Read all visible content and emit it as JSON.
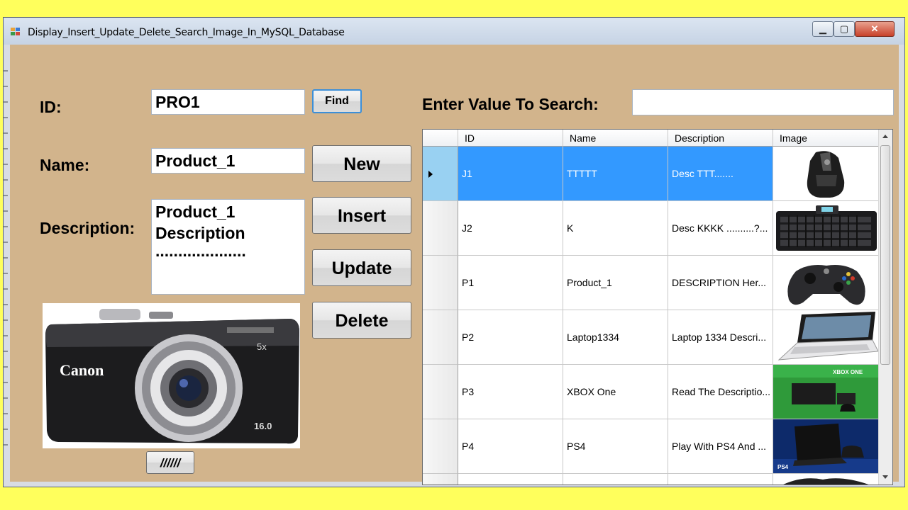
{
  "window": {
    "title": "Display_Insert_Update_Delete_Search_Image_In_MySQL_Database"
  },
  "form": {
    "id_label": "ID:",
    "id_value": "PRO1",
    "find_label": "Find",
    "name_label": "Name:",
    "name_value": "Product_1",
    "desc_label": "Description:",
    "desc_lines": [
      "Product_1",
      "Description",
      "...................."
    ],
    "search_label": "Enter Value To Search:",
    "search_value": "",
    "buttons": {
      "new": "New",
      "insert": "Insert",
      "update": "Update",
      "delete": "Delete",
      "browse": "//////"
    },
    "photo_brand": "Canon",
    "photo_zoom": "5x",
    "photo_mp": "16.0"
  },
  "grid": {
    "columns": [
      "ID",
      "Name",
      "Description",
      "Image"
    ],
    "rows": [
      {
        "id": "J1",
        "name": "TTTTT",
        "desc": "Desc TTT.......",
        "image": "gaming-mouse"
      },
      {
        "id": "J2",
        "name": "K",
        "desc": "Desc KKKK ..........?...",
        "image": "keyboard"
      },
      {
        "id": "P1",
        "name": "Product_1",
        "desc": "DESCRIPTION Her...",
        "image": "game-controller"
      },
      {
        "id": "P2",
        "name": "Laptop1334",
        "desc": "Laptop 1334 Descri...",
        "image": "laptop"
      },
      {
        "id": "P3",
        "name": "XBOX One",
        "desc": "Read The Descriptio...",
        "image": "xbox-console"
      },
      {
        "id": "P4",
        "name": "PS4",
        "desc": "Play With PS4 And ...",
        "image": "ps4-console"
      }
    ],
    "selected_index": 0,
    "xbox_banner": "XBOX ONE",
    "ps4_banner": "PS4"
  },
  "colors": {
    "form_bg": "#d2b48c",
    "selection": "#3399ff",
    "page_bg": "#ffff5c"
  }
}
